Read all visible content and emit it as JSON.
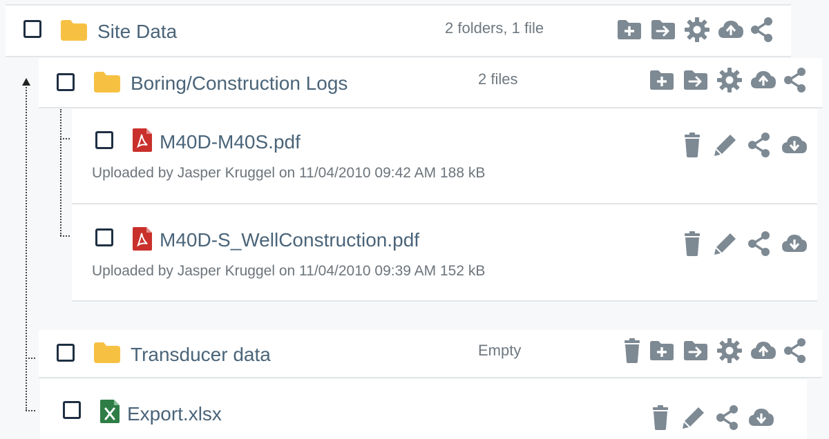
{
  "site_folder": {
    "name": "Site Data",
    "count": "2 folders, 1 file"
  },
  "boring_folder": {
    "name": "Boring/Construction Logs",
    "count": "2 files"
  },
  "files": [
    {
      "name": "M40D-M40S.pdf",
      "meta": "Uploaded by Jasper Kruggel on 11/04/2010 09:42 AM 188 kB",
      "type_icon": "pdf-file-icon"
    },
    {
      "name": "M40D-S_WellConstruction.pdf",
      "meta": "Uploaded by Jasper Kruggel on 11/04/2010 09:39 AM 152 kB",
      "type_icon": "pdf-file-icon"
    }
  ],
  "transducer_folder": {
    "name": "Transducer data",
    "count": "Empty"
  },
  "export_file": {
    "name": "Export.xlsx",
    "type_icon": "excel-file-icon"
  },
  "colors": {
    "folder": "#f6c143",
    "pdf": "#c9302c",
    "excel": "#2e7d46",
    "action_icon": "#7d8993",
    "name_text": "#4a6479",
    "checkbox": "#1e2f42"
  }
}
